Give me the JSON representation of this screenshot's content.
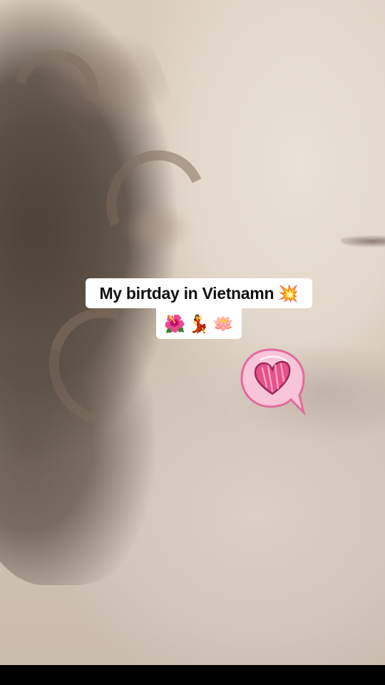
{
  "caption": {
    "line1_text": "My birtday in Vietnamn",
    "line1_emoji": "💥",
    "line2_emojis": [
      "🌺",
      "💃",
      "🪷"
    ]
  },
  "stickers": {
    "heart_bubble_icon": "heart-speech-bubble-icon"
  },
  "colors": {
    "caption_background": "#ffffff",
    "caption_text": "#111111",
    "heart_fill": "#e8508a",
    "bubble_fill": "#f7c4d8",
    "bubble_outline": "#e46a9c"
  }
}
